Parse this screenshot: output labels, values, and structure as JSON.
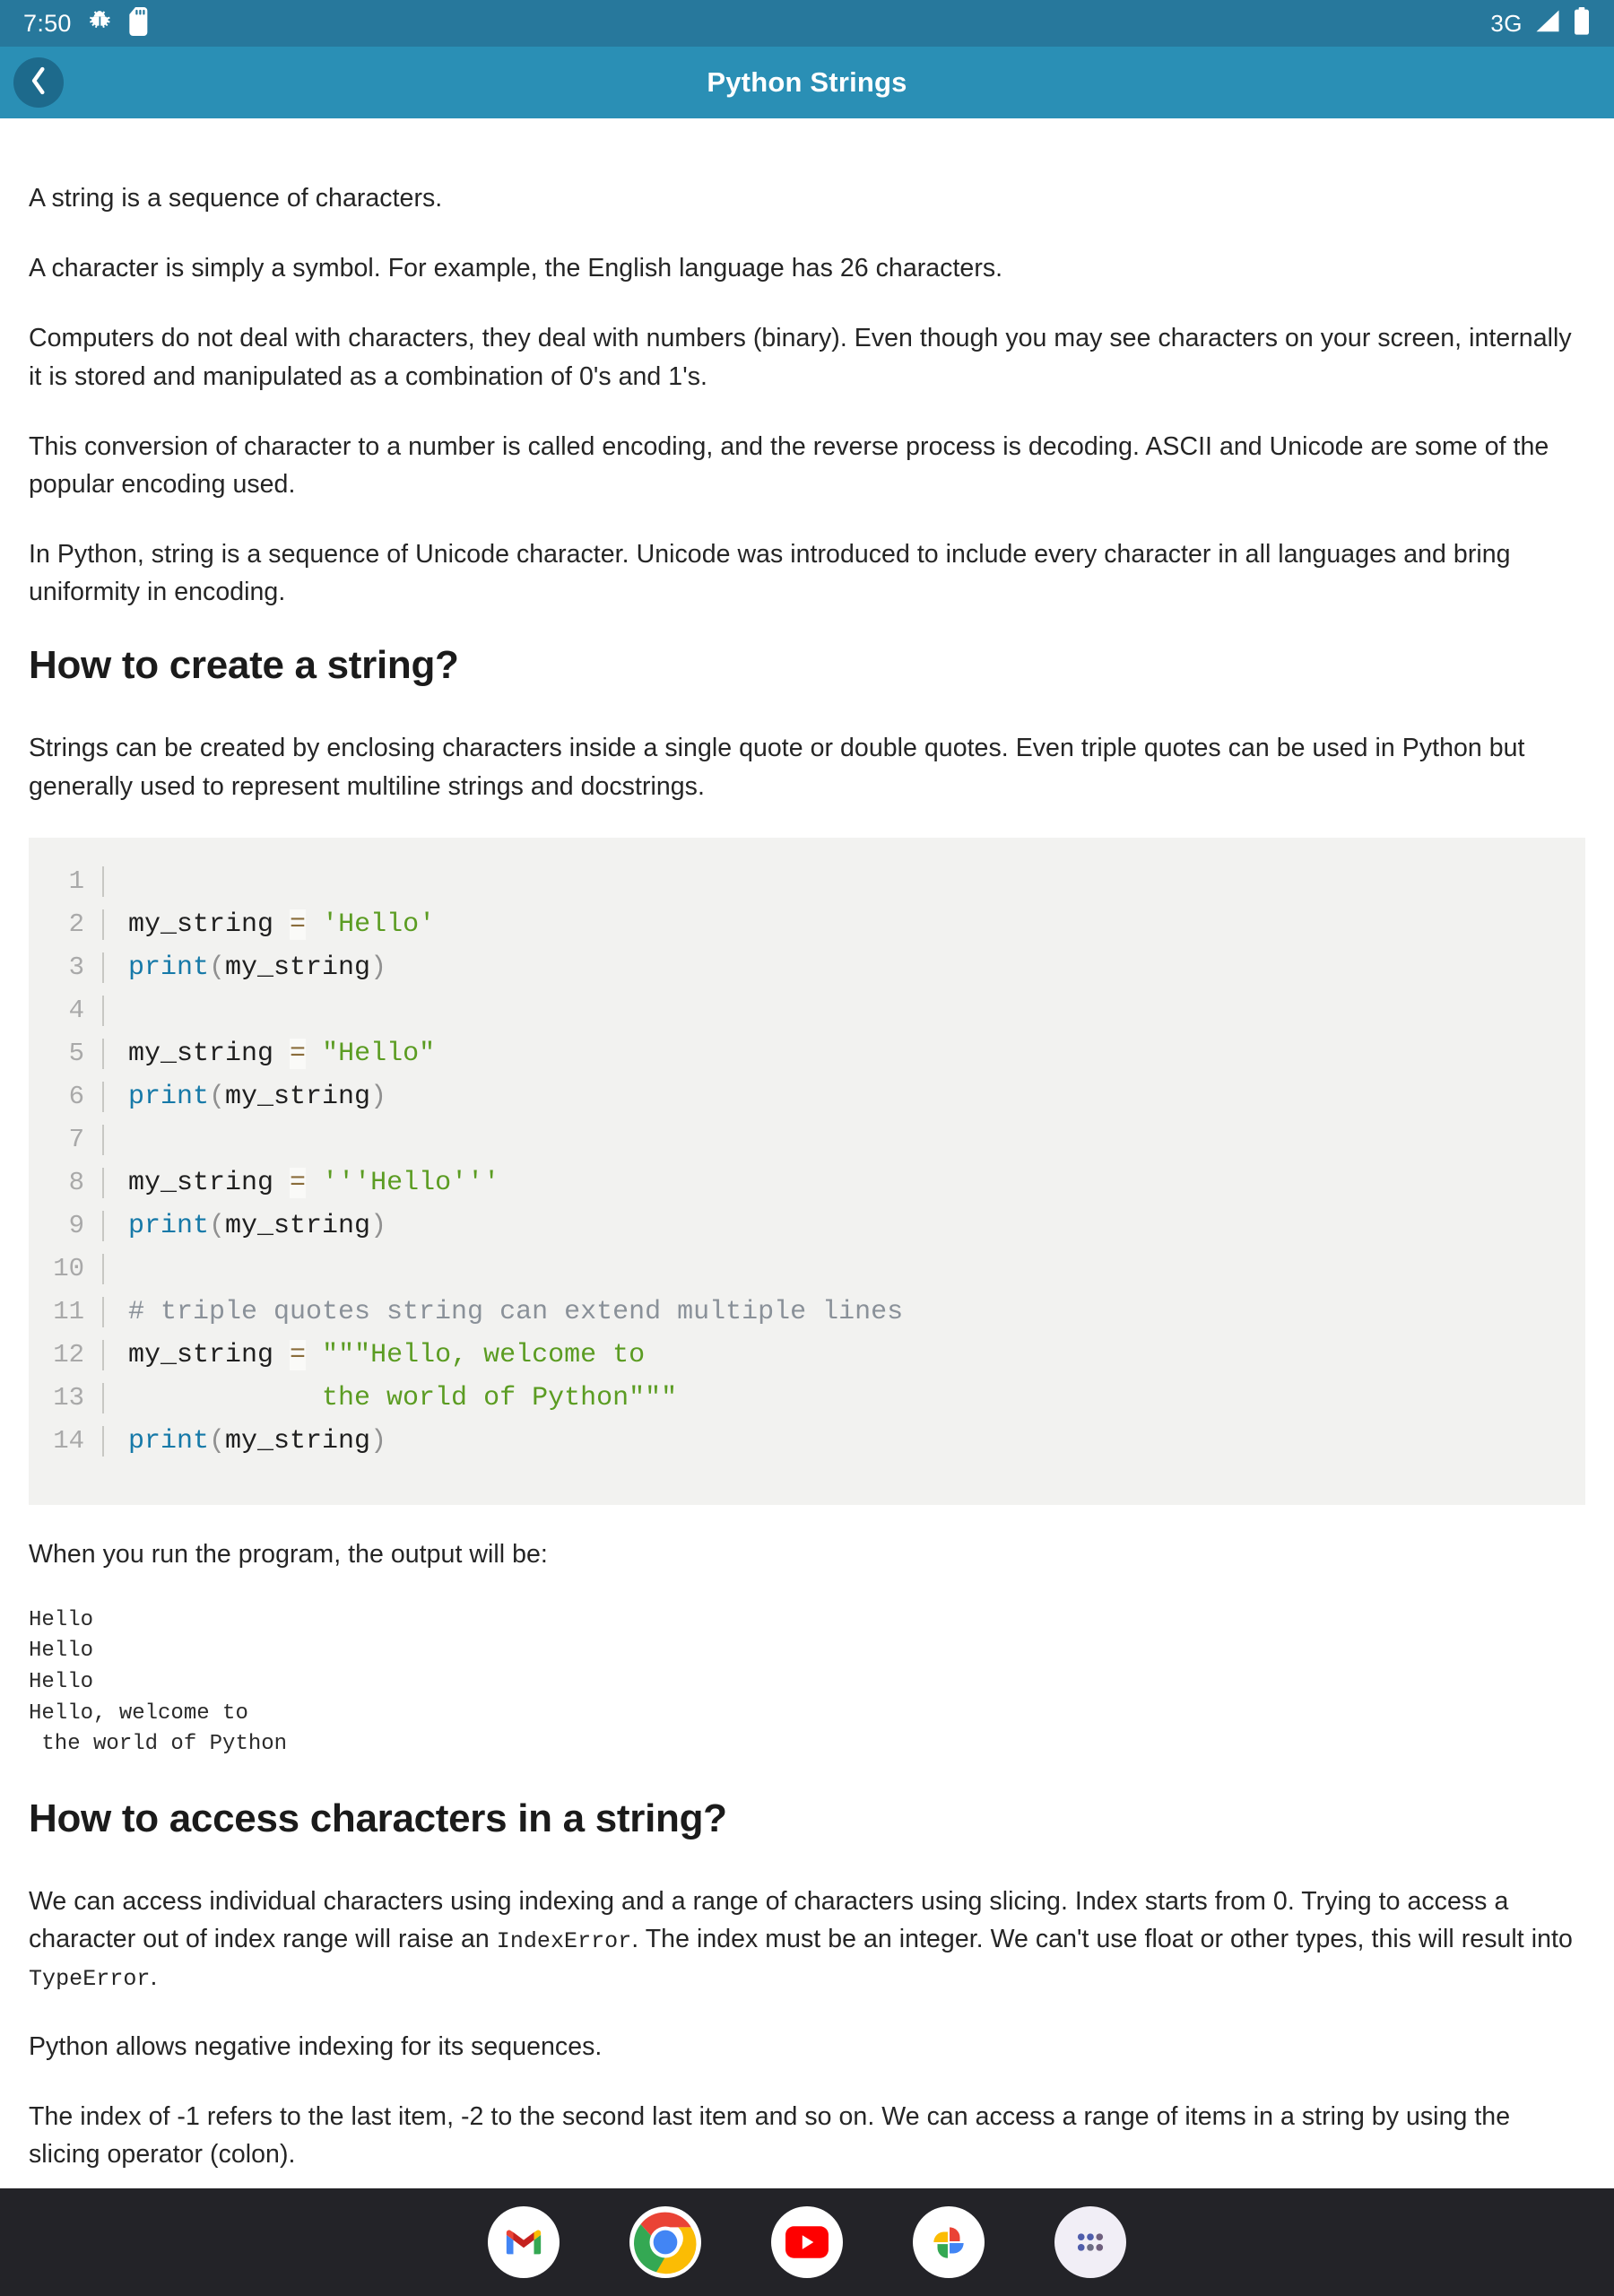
{
  "status_bar": {
    "clock": "7:50",
    "network": "3G",
    "icons": {
      "debug": "android-bug-icon",
      "sdcard": "sd-card-icon",
      "signal": "signal-bars-icon",
      "battery": "battery-icon"
    },
    "background_color": "#27789c"
  },
  "app_bar": {
    "title": "Python Strings",
    "back_icon": "chevron-left-icon",
    "background_color": "#2a8fb5"
  },
  "article": {
    "paragraphs": {
      "p1": "A string is a sequence of characters.",
      "p2": "A character is simply a symbol. For example, the English language has 26 characters.",
      "p3": "Computers do not deal with characters, they deal with numbers (binary). Even though you may see characters on your screen, internally it is stored and manipulated as a combination of 0's and 1's.",
      "p4": "This conversion of character to a number is called encoding, and the reverse process is decoding. ASCII and Unicode are some of the popular encoding used.",
      "p5": "In Python, string is a sequence of Unicode character. Unicode was introduced to include every character in all languages and bring uniformity in encoding.",
      "p6": "Strings can be created by enclosing characters inside a single quote or double quotes. Even triple quotes can be used in Python but generally used to represent multiline strings and docstrings.",
      "p7": "When you run the program, the output will be:",
      "p8_a": "We can access individual characters using indexing and a range of characters using slicing. Index starts from 0. Trying to access a character out of index range will raise an ",
      "p8_code1": "IndexError",
      "p8_b": ". The index must be an integer. We can't use float or other types, this will result into ",
      "p8_code2": "TypeError",
      "p8_c": ".",
      "p9": "Python allows negative indexing for its sequences.",
      "p10": "The index of -1 refers to the last item, -2 to the second last item and so on. We can access a range of items in a string by using the slicing operator (colon)."
    },
    "headings": {
      "h1": "How to create a string?",
      "h2": "How to access characters in a string?"
    },
    "code_block": {
      "language": "python",
      "line_numbers": [
        "1",
        "2",
        "3",
        "4",
        "5",
        "6",
        "7",
        "8",
        "9",
        "10",
        "11",
        "12",
        "13",
        "14"
      ],
      "lines": [
        {
          "n": "1",
          "tokens": []
        },
        {
          "n": "2",
          "tokens": [
            {
              "t": "my_string ",
              "c": "tok-var"
            },
            {
              "t": "=",
              "c": "tok-op"
            },
            {
              "t": " ",
              "c": "tok-var"
            },
            {
              "t": "'Hello'",
              "c": "tok-str"
            }
          ]
        },
        {
          "n": "3",
          "tokens": [
            {
              "t": "print",
              "c": "tok-fn"
            },
            {
              "t": "(",
              "c": "tok-paren"
            },
            {
              "t": "my_string",
              "c": "tok-var"
            },
            {
              "t": ")",
              "c": "tok-paren"
            }
          ]
        },
        {
          "n": "4",
          "tokens": []
        },
        {
          "n": "5",
          "tokens": [
            {
              "t": "my_string ",
              "c": "tok-var"
            },
            {
              "t": "=",
              "c": "tok-op"
            },
            {
              "t": " ",
              "c": "tok-var"
            },
            {
              "t": "\"Hello\"",
              "c": "tok-str"
            }
          ]
        },
        {
          "n": "6",
          "tokens": [
            {
              "t": "print",
              "c": "tok-fn"
            },
            {
              "t": "(",
              "c": "tok-paren"
            },
            {
              "t": "my_string",
              "c": "tok-var"
            },
            {
              "t": ")",
              "c": "tok-paren"
            }
          ]
        },
        {
          "n": "7",
          "tokens": []
        },
        {
          "n": "8",
          "tokens": [
            {
              "t": "my_string ",
              "c": "tok-var"
            },
            {
              "t": "=",
              "c": "tok-op"
            },
            {
              "t": " ",
              "c": "tok-var"
            },
            {
              "t": "'''Hello'''",
              "c": "tok-str"
            }
          ]
        },
        {
          "n": "9",
          "tokens": [
            {
              "t": "print",
              "c": "tok-fn"
            },
            {
              "t": "(",
              "c": "tok-paren"
            },
            {
              "t": "my_string",
              "c": "tok-var"
            },
            {
              "t": ")",
              "c": "tok-paren"
            }
          ]
        },
        {
          "n": "10",
          "tokens": []
        },
        {
          "n": "11",
          "tokens": [
            {
              "t": "# triple quotes string can extend multiple lines",
              "c": "tok-comment"
            }
          ]
        },
        {
          "n": "12",
          "tokens": [
            {
              "t": "my_string ",
              "c": "tok-var"
            },
            {
              "t": "=",
              "c": "tok-op"
            },
            {
              "t": " ",
              "c": "tok-var"
            },
            {
              "t": "\"\"\"Hello, welcome to",
              "c": "tok-str"
            }
          ]
        },
        {
          "n": "13",
          "tokens": [
            {
              "t": "            the world of Python\"\"\"",
              "c": "tok-str"
            }
          ]
        },
        {
          "n": "14",
          "tokens": [
            {
              "t": "print",
              "c": "tok-fn"
            },
            {
              "t": "(",
              "c": "tok-paren"
            },
            {
              "t": "my_string",
              "c": "tok-var"
            },
            {
              "t": ")",
              "c": "tok-paren"
            }
          ]
        }
      ]
    },
    "output": "Hello\nHello\nHello\nHello, welcome to\n the world of Python"
  },
  "nav_bar": {
    "background_color": "#232328",
    "items": [
      {
        "name": "gmail-icon",
        "label": "Gmail"
      },
      {
        "name": "chrome-icon",
        "label": "Chrome"
      },
      {
        "name": "youtube-icon",
        "label": "YouTube"
      },
      {
        "name": "google-photos-icon",
        "label": "Photos"
      },
      {
        "name": "app-drawer-icon",
        "label": "Apps"
      }
    ]
  }
}
